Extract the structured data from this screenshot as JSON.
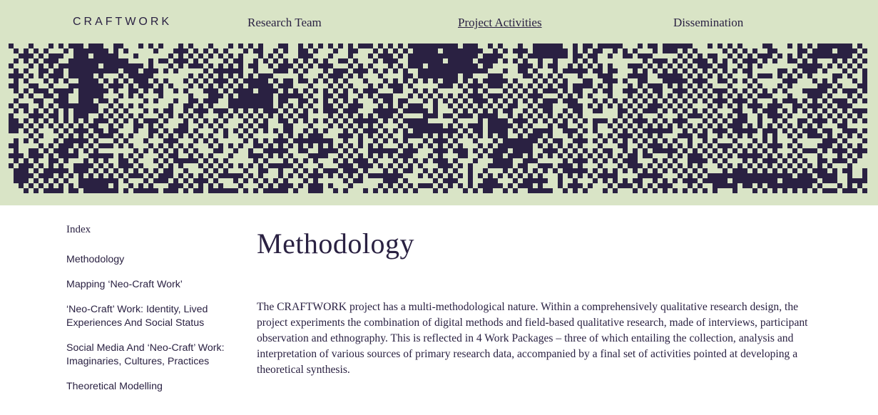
{
  "header": {
    "logo": "CRAFTWORK",
    "nav": [
      {
        "label": "Research Team",
        "active": false
      },
      {
        "label": "Project Activities",
        "active": true
      },
      {
        "label": "Dissemination",
        "active": false
      }
    ]
  },
  "colors": {
    "background_band": "#d9e4c6",
    "ink": "#2a2142"
  },
  "sidebar": {
    "index_label": "Index",
    "items": [
      {
        "label": "Methodology"
      },
      {
        "label": "Mapping ‘Neo-Craft Work’"
      },
      {
        "label": "‘Neo-Craft’ Work: Identity, Lived Experiences And Social Status"
      },
      {
        "label": "Social Media And ‘Neo-Craft’ Work: Imaginaries, Cultures, Practices"
      },
      {
        "label": "Theoretical Modelling"
      }
    ]
  },
  "main": {
    "title": "Methodology",
    "body": "The CRAFTWORK project has a multi-methodological nature. Within a comprehensively qualitative research design, the project experiments the combination of digital methods and field-based qualitative research, made of interviews, participant observation and ethnography. This is reflected in 4 Work Packages – three of which entailing the collection, analysis and interpretation of various sources of primary research data, accompanied by a final set of activities pointed at developing a theoretical synthesis."
  }
}
